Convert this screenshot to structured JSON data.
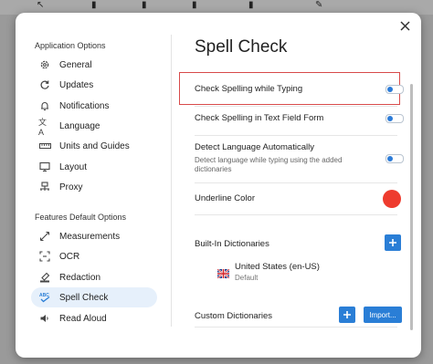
{
  "dialog": {
    "close_icon": "close-icon"
  },
  "sidebar": {
    "sections": [
      {
        "title": "Application Options",
        "items": [
          {
            "label": "General",
            "icon": "gear-icon"
          },
          {
            "label": "Updates",
            "icon": "refresh-icon"
          },
          {
            "label": "Notifications",
            "icon": "bell-icon"
          },
          {
            "label": "Language",
            "icon": "translate-icon"
          },
          {
            "label": "Units and Guides",
            "icon": "ruler-icon"
          },
          {
            "label": "Layout",
            "icon": "monitor-icon"
          },
          {
            "label": "Proxy",
            "icon": "network-icon"
          }
        ]
      },
      {
        "title": "Features Default Options",
        "items": [
          {
            "label": "Measurements",
            "icon": "measure-icon"
          },
          {
            "label": "OCR",
            "icon": "ocr-icon"
          },
          {
            "label": "Redaction",
            "icon": "redaction-icon"
          },
          {
            "label": "Spell Check",
            "icon": "spellcheck-icon",
            "active": true
          },
          {
            "label": "Read Aloud",
            "icon": "speaker-icon"
          }
        ]
      }
    ]
  },
  "main": {
    "title": "Spell Check",
    "settings": {
      "check_while_typing": {
        "label": "Check Spelling while Typing",
        "enabled": true
      },
      "check_text_fields": {
        "label": "Check Spelling in Text Field Form",
        "enabled": true
      },
      "detect_language": {
        "label": "Detect Language Automatically",
        "description": "Detect language while typing using the added dictionaries",
        "enabled": true
      },
      "underline_color": {
        "label": "Underline Color",
        "color": "#ee3b2e"
      }
    },
    "builtin": {
      "title": "Built-In Dictionaries",
      "dictionary": {
        "name": "United States (en-US)",
        "sub": "Default"
      }
    },
    "custom": {
      "title": "Custom Dictionaries",
      "import_label": "Import..."
    }
  },
  "colors": {
    "accent": "#2a7ed6",
    "highlight_border": "#d84a4a",
    "active_nav_bg": "#e6f0fb"
  }
}
